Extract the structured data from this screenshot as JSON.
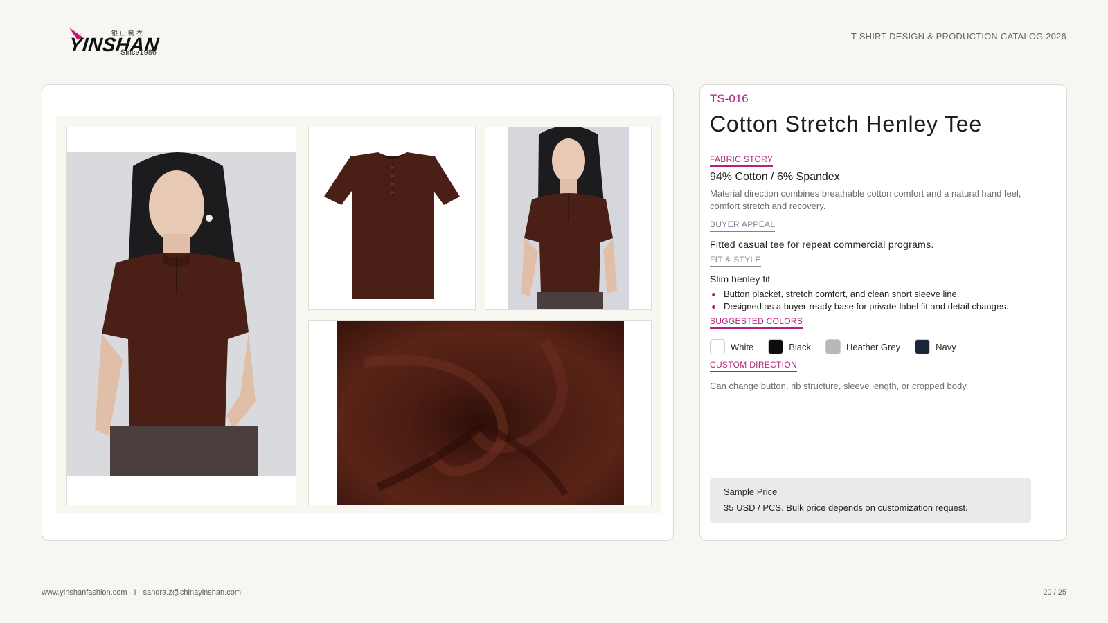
{
  "brand": {
    "chinese_name": "银山制衣",
    "wordmark": "YINSHAN",
    "since": "Since1986",
    "accent_color": "#b5227e"
  },
  "header": {
    "catalog_title": "T-SHIRT DESIGN & PRODUCTION CATALOG 2026"
  },
  "product": {
    "code": "TS-016",
    "name": "Cotton Stretch Henley Tee",
    "garment_color": "#4a2016"
  },
  "sections": {
    "fabric_story": {
      "label": "FABRIC STORY",
      "composition": "94% Cotton / 6% Spandex",
      "description": "Material direction combines breathable cotton comfort and a natural hand feel, comfort stretch and recovery."
    },
    "buyer_appeal": {
      "label": "BUYER APPEAL",
      "text": "Fitted casual tee for repeat commercial programs."
    },
    "fit_style": {
      "label": "FIT & STYLE",
      "fit": "Slim henley fit",
      "bullets": [
        "Button placket, stretch comfort, and clean short sleeve line.",
        "Designed as a buyer-ready base for private-label fit and detail changes."
      ]
    },
    "suggested_colors": {
      "label": "SUGGESTED COLORS",
      "colors": [
        {
          "name": "White",
          "hex": "#ffffff"
        },
        {
          "name": "Black",
          "hex": "#0d0d0d"
        },
        {
          "name": "Heather Grey",
          "hex": "#b8b8b4"
        },
        {
          "name": "Navy",
          "hex": "#1b2638"
        }
      ]
    },
    "custom_direction": {
      "label": "CUSTOM DIRECTION",
      "text": "Can change button, rib structure, sleeve length, or cropped body."
    }
  },
  "price": {
    "title": "Sample Price",
    "text": "35 USD / PCS. Bulk price depends on customization request."
  },
  "footer": {
    "website": "www.yinshanfashion.com",
    "separator": "I",
    "email": "sandra.z@chinayinshan.com",
    "page": "20 / 25"
  }
}
